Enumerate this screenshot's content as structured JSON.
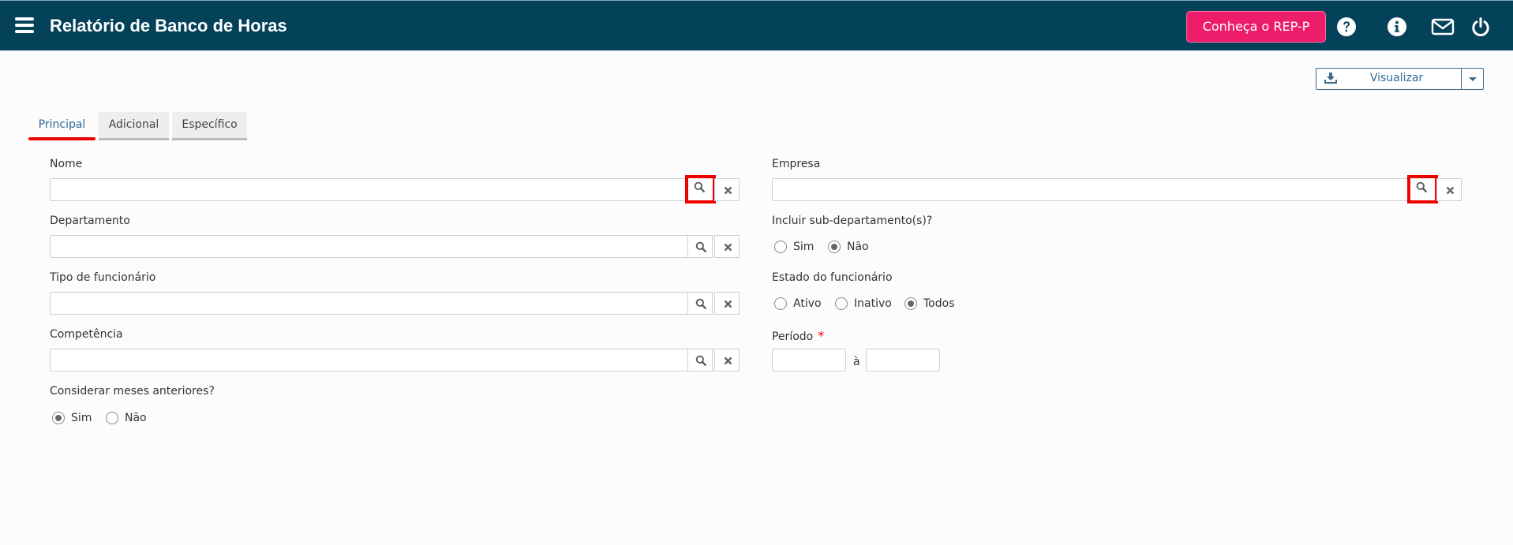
{
  "header": {
    "title": "Relatório de Banco de Horas",
    "rep_button": "Conheça o REP-P",
    "icons": [
      "help-icon",
      "info-icon",
      "mail-icon",
      "power-icon"
    ],
    "background": "#04425a",
    "accent": "#ee1d6c"
  },
  "toolbar": {
    "visualizar_label": "Visualizar",
    "icons": [
      "download-icon",
      "caret-down-icon"
    ]
  },
  "tabs": [
    {
      "label": "Principal",
      "active": true
    },
    {
      "label": "Adicional",
      "active": false
    },
    {
      "label": "Específico",
      "active": false
    }
  ],
  "form": {
    "nome": {
      "label": "Nome",
      "value": ""
    },
    "empresa": {
      "label": "Empresa",
      "value": ""
    },
    "departamento": {
      "label": "Departamento",
      "value": ""
    },
    "sub_departamento": {
      "label": "Incluir sub-departamento(s)?",
      "options": [
        "Sim",
        "Não"
      ],
      "selected": "Não"
    },
    "tipo_funcionario": {
      "label": "Tipo de funcionário",
      "value": ""
    },
    "estado_funcionario": {
      "label": "Estado do funcionário",
      "options": [
        "Ativo",
        "Inativo",
        "Todos"
      ],
      "selected": "Todos"
    },
    "competencia": {
      "label": "Competência",
      "value": ""
    },
    "periodo": {
      "label": "Período",
      "required_mark": "*",
      "separator": "à",
      "start": "",
      "end": ""
    },
    "meses_anteriores": {
      "label": "Considerar meses anteriores?",
      "options": [
        "Sim",
        "Não"
      ],
      "selected": "Sim"
    }
  }
}
